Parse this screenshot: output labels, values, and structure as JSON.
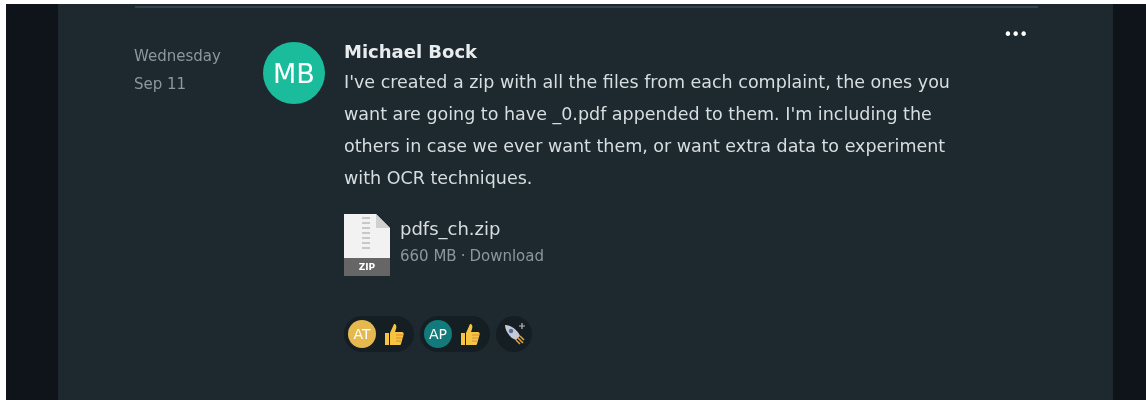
{
  "date": {
    "day": "Wednesday",
    "date": "Sep 11"
  },
  "message": {
    "author": "Michael Bock",
    "avatar": {
      "initials": "MB",
      "color": "#1abc9c"
    },
    "text": "I've created a zip with all the files from each complaint, the ones you want are going to have _0.pdf appended to them. I'm including the others in case we ever want them, or want extra data to experiment with OCR techniques.",
    "menu": "•••"
  },
  "attachment": {
    "name": "pdfs_ch.zip",
    "size": "660 MB",
    "separator": "·",
    "action": "Download",
    "type_label": "ZIP"
  },
  "reactions": [
    {
      "initials": "AT",
      "color": "#e6b94f"
    },
    {
      "initials": "AP",
      "color": "#127a7a"
    }
  ]
}
